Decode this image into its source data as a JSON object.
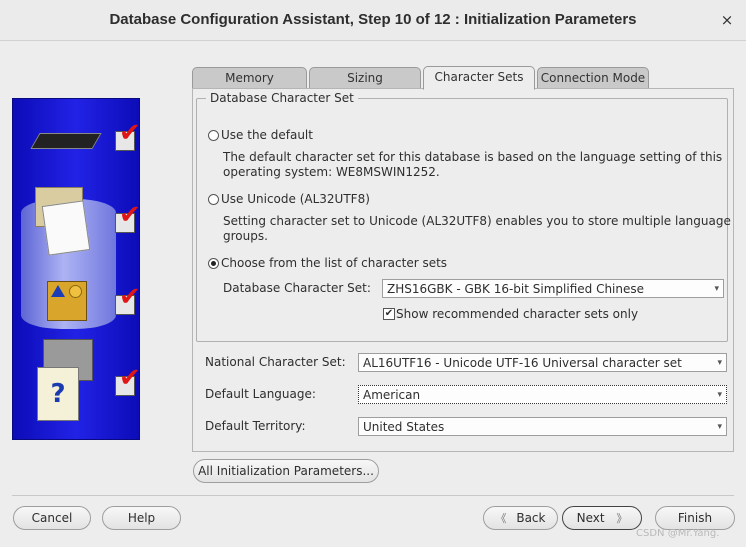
{
  "window": {
    "title": "Database Configuration Assistant, Step 10 of 12 : Initialization Parameters",
    "close_glyph": "×"
  },
  "tabs": [
    {
      "label": "Memory",
      "active": false
    },
    {
      "label": "Sizing",
      "active": false
    },
    {
      "label": "Character Sets",
      "active": true
    },
    {
      "label": "Connection Mode",
      "active": false
    }
  ],
  "db_charset": {
    "legend": "Database Character Set",
    "option_default": {
      "label": "Use the default",
      "selected": false,
      "desc1": "The default character set for this database is based on the language setting of this",
      "desc2": "operating system: WE8MSWIN1252."
    },
    "option_unicode": {
      "label": "Use Unicode (AL32UTF8)",
      "selected": false,
      "desc1": "Setting character set to Unicode (AL32UTF8) enables you to store multiple language",
      "desc2": "groups."
    },
    "option_list": {
      "label": "Choose from the list of character sets",
      "selected": true
    },
    "charset_label": "Database Character Set:",
    "charset_value": "ZHS16GBK - GBK 16-bit Simplified Chinese",
    "show_recommended": {
      "label": "Show recommended character sets only",
      "checked": true,
      "glyph": "✔"
    }
  },
  "national": {
    "label": "National Character Set:",
    "value": "AL16UTF16 - Unicode UTF-16 Universal character set"
  },
  "language": {
    "label": "Default Language:",
    "value": "American"
  },
  "territory": {
    "label": "Default Territory:",
    "value": "United States"
  },
  "all_params_button": "All Initialization Parameters...",
  "footer": {
    "cancel": "Cancel",
    "help": "Help",
    "back": "Back",
    "back_glyph": "《",
    "next": "Next",
    "next_glyph": "》",
    "finish": "Finish"
  },
  "watermark": "CSDN @Mr.Yang.",
  "icons": {
    "dropdown": "▾",
    "check_mark": "✔"
  },
  "colors": {
    "art_panel": "#1414d0",
    "check_red": "#e01515"
  }
}
